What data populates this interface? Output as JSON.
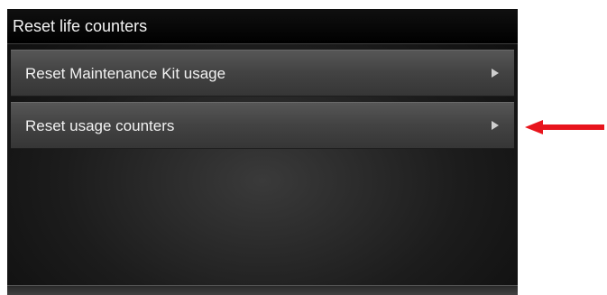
{
  "screen": {
    "title": "Reset life counters",
    "menu": [
      {
        "label": "Reset Maintenance Kit usage",
        "icon": "chevron-right-icon"
      },
      {
        "label": "Reset usage counters",
        "icon": "chevron-right-icon"
      }
    ]
  },
  "annotation": {
    "icon": "red-arrow-icon",
    "color": "#e8141c"
  }
}
